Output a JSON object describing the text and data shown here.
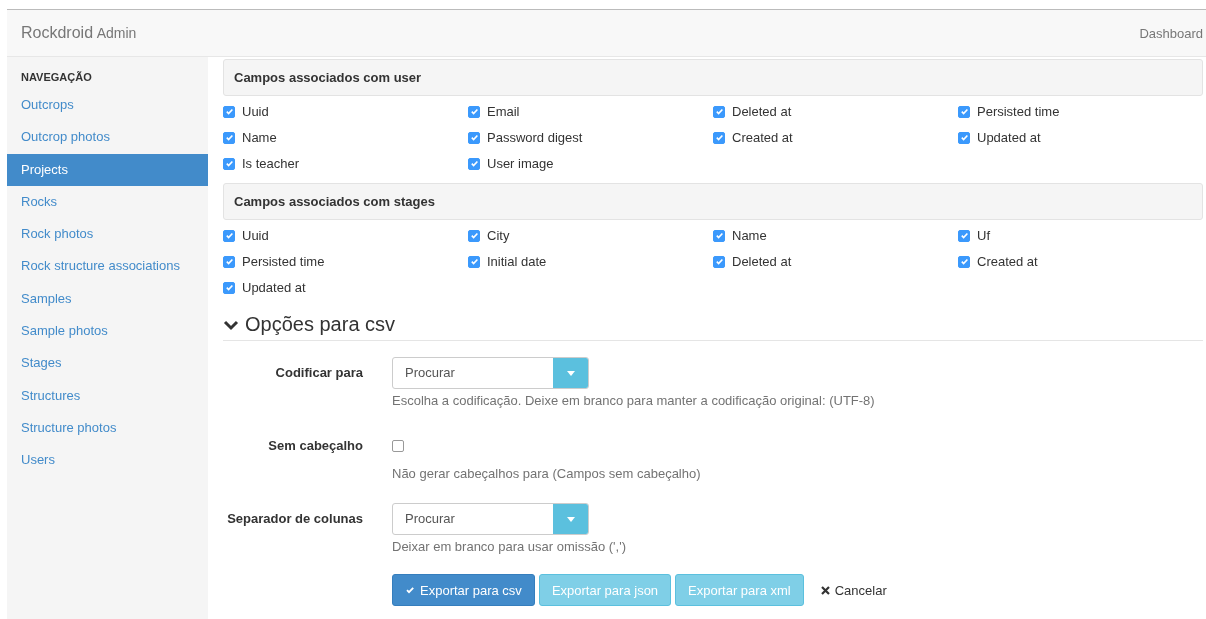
{
  "header": {
    "brand": "Rockdroid",
    "brand_suffix": "Admin",
    "nav_link": "Dashboard"
  },
  "sidebar": {
    "heading": "NAVEGAÇÃO",
    "items": [
      {
        "label": "Outcrops",
        "selected": false
      },
      {
        "label": "Outcrop photos",
        "selected": false
      },
      {
        "label": "Projects",
        "selected": true
      },
      {
        "label": "Rocks",
        "selected": false
      },
      {
        "label": "Rock photos",
        "selected": false
      },
      {
        "label": "Rock structure associations",
        "selected": false
      },
      {
        "label": "Samples",
        "selected": false
      },
      {
        "label": "Sample photos",
        "selected": false
      },
      {
        "label": "Stages",
        "selected": false
      },
      {
        "label": "Structures",
        "selected": false
      },
      {
        "label": "Structure photos",
        "selected": false
      },
      {
        "label": "Users",
        "selected": false
      }
    ]
  },
  "field_groups": [
    {
      "title": "Campos associados com user",
      "fields": [
        {
          "label": "Uuid",
          "checked": true
        },
        {
          "label": "Email",
          "checked": true
        },
        {
          "label": "Deleted at",
          "checked": true
        },
        {
          "label": "Persisted time",
          "checked": true
        },
        {
          "label": "Name",
          "checked": true
        },
        {
          "label": "Password digest",
          "checked": true
        },
        {
          "label": "Created at",
          "checked": true
        },
        {
          "label": "Updated at",
          "checked": true
        },
        {
          "label": "Is teacher",
          "checked": true
        },
        {
          "label": "User image",
          "checked": true
        }
      ]
    },
    {
      "title": "Campos associados com stages",
      "fields": [
        {
          "label": "Uuid",
          "checked": true
        },
        {
          "label": "City",
          "checked": true
        },
        {
          "label": "Name",
          "checked": true
        },
        {
          "label": "Uf",
          "checked": true
        },
        {
          "label": "Persisted time",
          "checked": true
        },
        {
          "label": "Initial date",
          "checked": true
        },
        {
          "label": "Deleted at",
          "checked": true
        },
        {
          "label": "Created at",
          "checked": true
        },
        {
          "label": "Updated at",
          "checked": true
        }
      ]
    }
  ],
  "csv_options": {
    "title": "Opções para csv",
    "expanded": true,
    "rows": [
      {
        "kind": "select",
        "label": "Codificar para",
        "placeholder": "Procurar",
        "help": "Escolha a codificação. Deixe em branco para manter a codificação original: (UTF-8)"
      },
      {
        "kind": "checkbox",
        "label": "Sem cabeçalho",
        "checked": false,
        "help": "Não gerar cabeçalhos para (Campos sem cabeçalho)"
      },
      {
        "kind": "select",
        "label": "Separador de colunas",
        "placeholder": "Procurar",
        "help": "Deixar em branco para usar omissão (',')"
      }
    ]
  },
  "actions": [
    {
      "kind": "primary",
      "label": "Exportar para csv"
    },
    {
      "kind": "info",
      "label": "Exportar para json"
    },
    {
      "kind": "info",
      "label": "Exportar para xml"
    },
    {
      "kind": "cancel",
      "label": "Cancelar"
    }
  ]
}
